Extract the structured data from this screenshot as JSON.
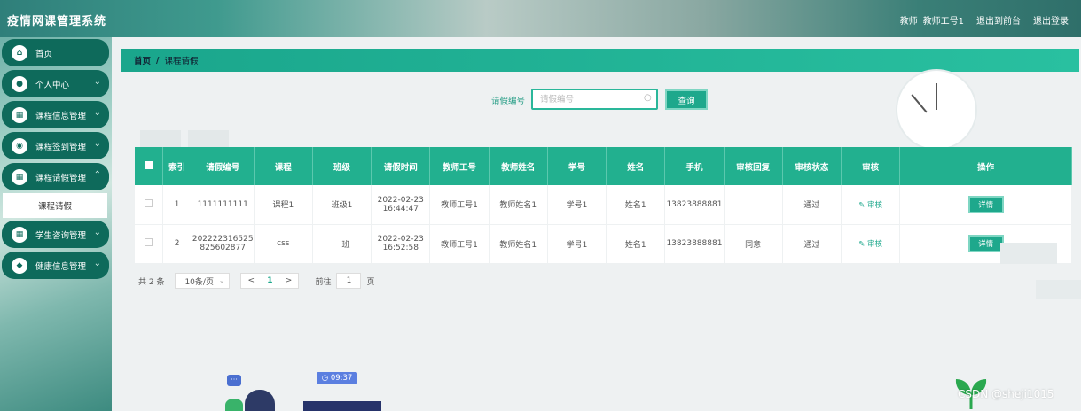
{
  "app": {
    "title": "疫情网课管理系统"
  },
  "header": {
    "user_role": "教师",
    "user_name": "教师工号1",
    "back_front": "退出到前台",
    "logout": "退出登录"
  },
  "sidebar": {
    "items": [
      {
        "label": "首页",
        "icon": "home-icon",
        "expandable": false
      },
      {
        "label": "个人中心",
        "icon": "user-icon",
        "expandable": true
      },
      {
        "label": "课程信息管理",
        "icon": "grid-icon",
        "expandable": true
      },
      {
        "label": "课程签到管理",
        "icon": "camera-icon",
        "expandable": true
      },
      {
        "label": "课程请假管理",
        "icon": "grid-icon",
        "expandable": true
      },
      {
        "label": "学生咨询管理",
        "icon": "grid-icon",
        "expandable": true
      },
      {
        "label": "健康信息管理",
        "icon": "location-icon",
        "expandable": true
      }
    ],
    "active_sub": "课程请假"
  },
  "breadcrumb": {
    "home": "首页",
    "separator": "/",
    "current": "课程请假"
  },
  "search": {
    "label": "请假编号",
    "placeholder": "请假编号",
    "button": "查询"
  },
  "table": {
    "headers": [
      "",
      "索引",
      "请假编号",
      "课程",
      "班级",
      "请假时间",
      "教师工号",
      "教师姓名",
      "学号",
      "姓名",
      "手机",
      "审核回复",
      "审核状态",
      "审核",
      "操作"
    ],
    "rows": [
      {
        "index": "1",
        "leave_no": "1111111111",
        "course": "课程1",
        "class": "班级1",
        "date": "2022-02-23",
        "time": "16:44:47",
        "teacher_no": "教师工号1",
        "teacher_name": "教师姓名1",
        "student_no": "学号1",
        "name": "姓名1",
        "phone": "13823888881",
        "reply": "",
        "status": "通过",
        "audit": "审核",
        "action": "详情"
      },
      {
        "index": "2",
        "leave_no_1": "202222316525",
        "leave_no_2": "825602877",
        "course": "css",
        "class": "一班",
        "date": "2022-02-23",
        "time": "16:52:58",
        "teacher_no": "教师工号1",
        "teacher_name": "教师姓名1",
        "student_no": "学号1",
        "name": "姓名1",
        "phone": "13823888881",
        "reply": "同意",
        "status": "通过",
        "audit": "审核",
        "action": "详情"
      }
    ]
  },
  "pagination": {
    "total": "共 2 条",
    "page_size": "10条/页",
    "prev": "<",
    "current": "1",
    "next": ">",
    "goto_label": "前往",
    "goto_value": "1",
    "page_word": "页"
  },
  "decor": {
    "time_tag": "09:37",
    "watermark": "CSDN @sheji1015"
  },
  "colors": {
    "accent": "#22b08f",
    "menu": "#0e6a5b"
  }
}
